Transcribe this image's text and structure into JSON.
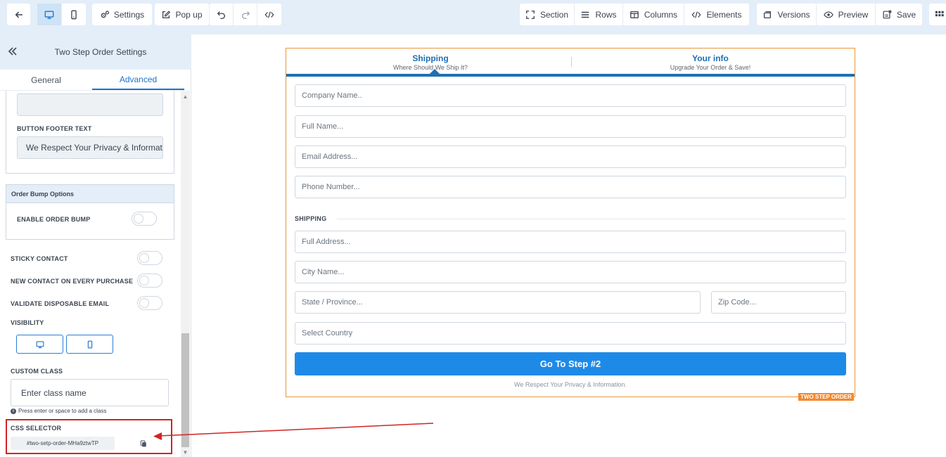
{
  "toolbar": {
    "settings_label": "Settings",
    "popup_label": "Pop up",
    "section_label": "Section",
    "rows_label": "Rows",
    "columns_label": "Columns",
    "elements_label": "Elements",
    "versions_label": "Versions",
    "preview_label": "Preview",
    "save_label": "Save"
  },
  "panel": {
    "title": "Two Step Order Settings",
    "tabs": [
      "General",
      "Advanced"
    ],
    "active_tab": "Advanced",
    "button_footer_label": "BUTTON FOOTER TEXT",
    "button_footer_value": "We Respect Your Privacy & Information.",
    "order_bump_header": "Order Bump Options",
    "enable_order_bump_label": "ENABLE ORDER BUMP",
    "sticky_contact_label": "STICKY CONTACT",
    "new_contact_label": "NEW CONTACT ON EVERY PURCHASE",
    "validate_email_label": "VALIDATE DISPOSABLE EMAIL",
    "visibility_label": "VISIBILITY",
    "custom_class_label": "CUSTOM CLASS",
    "custom_class_placeholder": "Enter class name",
    "custom_class_hint": "Press enter or space to add a class",
    "css_selector_label": "CSS SELECTOR",
    "css_selector_value": "#two-setp-order-MHa9ztwTP"
  },
  "form": {
    "step1_title": "Shipping",
    "step1_sub": "Where Should We Ship It?",
    "step2_title": "Your info",
    "step2_sub": "Upgrade Your Order & Save!",
    "company_placeholder": "Company Name..",
    "fullname_placeholder": "Full Name...",
    "email_placeholder": "Email Address...",
    "phone_placeholder": "Phone Number...",
    "shipping_heading": "SHIPPING",
    "address_placeholder": "Full Address...",
    "city_placeholder": "City Name...",
    "state_placeholder": "State / Province...",
    "zip_placeholder": "Zip Code...",
    "country_placeholder": "Select Country",
    "button_label": "Go To Step #2",
    "privacy_text": "We Respect Your Privacy & Information.",
    "badge_text": "TWO STEP ORDER"
  },
  "colors": {
    "accent": "#1e74c9",
    "toolbar_bg": "#e3eef9",
    "step_blue": "#1e6fb3",
    "cta_blue": "#1e8ae8",
    "frame_orange": "#e8963a",
    "badge_orange": "#f2892e",
    "annotation_red": "#d12424"
  }
}
